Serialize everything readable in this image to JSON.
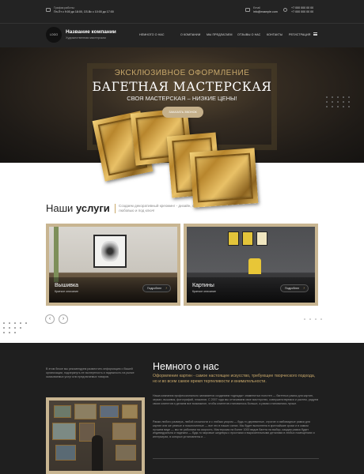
{
  "topbar": {
    "hours_label": "График работы:",
    "hours_value": "Пн-Пт с 9:00 до 18:00, Сб-Вс с 10:00 до 17:00",
    "email_label": "Email",
    "email_value": "info@example.com",
    "phone1": "+7 000 000 00 00",
    "phone2": "+7 000 000 00 00"
  },
  "header": {
    "logo": "LOGO",
    "company_name": "Название компании",
    "company_tagline": "Художественная мастерская",
    "nav": [
      "НЕМНОГО О НАС",
      "О КОМПАНИИ",
      "МЫ ПРЕДЛАГАЕМ",
      "ОТЗЫВЫ О НАС",
      "КОНТАКТЫ",
      "РЕГИСТРАЦИЯ"
    ]
  },
  "hero": {
    "subtitle": "ЭКСКЛЮЗИВНОЕ ОФОРМЛЕНИЕ",
    "title": "БАГЕТНАЯ МАСТЕРСКАЯ",
    "tagline": "СВОЯ МАСТЕРСКАЯ – НИЗКИЕ ЦЕНЫ!",
    "button": "ЗАКАЗАТЬ ЗВОНОК"
  },
  "services": {
    "title_light": "Наши",
    "title_bold": "услуги",
    "subtitle": "Создаем декоративный креоминг - дизайн, с любовью и под ключ!",
    "cards": [
      {
        "title": "Вышивка",
        "desc": "Краткое описание",
        "button": "Подробнее"
      },
      {
        "title": "Картины",
        "desc": "Краткое описание",
        "button": "Подробнее"
      }
    ],
    "prev": "‹",
    "next": "›"
  },
  "about": {
    "left_text": "В этом блоке мы рекомендуем разместить информацию о Вашей организации, подчеркнуть ее экспертность и надежность на рынке оказываемых услуг или предлагаемых товаров.",
    "title": "Немного о нас",
    "lead": "Оформление картин - самое настоящее искусство, требующее творческого подхода, но и во всем самое время терпеливости и внимательности.",
    "p1": "Наша компания профессионально занимается созданием «одежды» знаменитых полотен — багетных рамок для картин, зеркал, вышивок, фотографий, плакатов. С 2007 года мы оттачиваем свое мастерство, совершенствуемся и растем, радуем своих клиентов и делаем все возможное, чтобы клиентов становилось больше, а рамки становились лучше.",
    "p2": "Рамки любого размера, любой сложности и с любым узором — будь то деревянные, строгие и имбовидные рамки для картин или же резные и позолоченные — все это в наших силах. Мы будет выполнена в кратчайшие сроки и в самом лучшем виде — мы не работаем на скорость. Мастерская на более 1000 видов багета на выбор, каждая рамка будет индивидуальна и надежна — будь то мировые шедевры с простыми и выразительными деталями в любых помещениях и интерьерах, в которых установлены и ..."
  },
  "colors": {
    "gold": "#c9a96b",
    "dark": "#1f1f1f",
    "button_beige": "#c5b08a"
  }
}
